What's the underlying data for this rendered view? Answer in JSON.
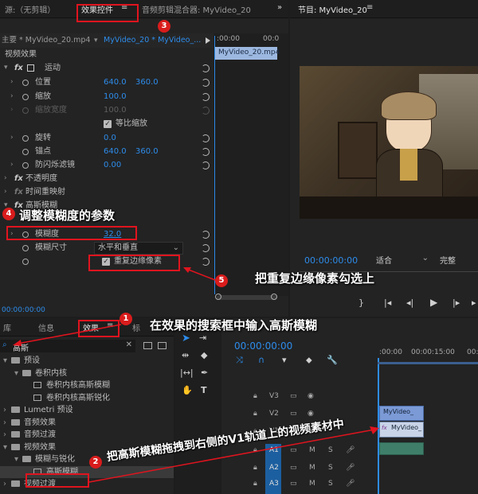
{
  "effect_controls": {
    "tabs": [
      "源:（无剪辑）",
      "效果控件",
      "音频剪辑混合器: MyVideo_20"
    ],
    "tab_menu": "≡",
    "more": "»",
    "breadcrumb_master": "主要 * MyVideo_20.mp4",
    "breadcrumb_seq": "MyVideo_20 * MyVideo_...",
    "ruler_start": ":00:00",
    "ruler_mid": "00:0",
    "clip_label": "MyVideo_20.mp4",
    "section_video": "视频效果",
    "motion": "运动",
    "position_label": "位置",
    "position_x": "640.0",
    "position_y": "360.0",
    "scale_label": "缩放",
    "scale_value": "100.0",
    "scale_width_label": "缩放宽度",
    "scale_width_value": "100.0",
    "uniform_scale": "等比缩放",
    "rotation_label": "旋转",
    "rotation_value": "0.0",
    "anchor_label": "锚点",
    "anchor_x": "640.0",
    "anchor_y": "360.0",
    "flicker_label": "防闪烁滤镜",
    "flicker_value": "0.00",
    "opacity": "不透明度",
    "time_remap": "时间重映射",
    "gaussian": "高斯模糊",
    "blurriness_label": "模糊度",
    "blurriness_value": "32.0",
    "blur_dim_label": "模糊尺寸",
    "blur_dim_value": "水平和垂直",
    "repeat_edge": "重复边缘像素",
    "footer_time": "00:00:00:00"
  },
  "program": {
    "title": "节目: MyVideo_20",
    "menu": "≡",
    "timecode": "00:00:00:00",
    "fit": "适合",
    "quality": "完整"
  },
  "effects": {
    "tabs": [
      "库",
      "信息",
      "效果",
      "标"
    ],
    "menu": "≡",
    "search_value": "高斯",
    "tree": [
      {
        "label": "预设",
        "indent": 0,
        "type": "folder",
        "expanded": true
      },
      {
        "label": "卷积内核",
        "indent": 1,
        "type": "folder",
        "expanded": true
      },
      {
        "label": "卷积内核高斯模糊",
        "indent": 2,
        "type": "preset"
      },
      {
        "label": "卷积内核高斯锐化",
        "indent": 2,
        "type": "preset"
      },
      {
        "label": "Lumetri 预设",
        "indent": 0,
        "type": "folder",
        "expanded": false
      },
      {
        "label": "音频效果",
        "indent": 0,
        "type": "folder",
        "expanded": false
      },
      {
        "label": "音频过渡",
        "indent": 0,
        "type": "folder",
        "expanded": false
      },
      {
        "label": "视频效果",
        "indent": 0,
        "type": "folder",
        "expanded": true
      },
      {
        "label": "模糊与锐化",
        "indent": 1,
        "type": "folder",
        "expanded": true
      },
      {
        "label": "高斯模糊",
        "indent": 2,
        "type": "effect",
        "selected": true
      },
      {
        "label": "视频过渡",
        "indent": 0,
        "type": "folder",
        "expanded": false
      }
    ]
  },
  "timeline": {
    "timecode": "00:00:00:00",
    "ruler_start": ":00:00",
    "ruler_mid": "00:00:15:00",
    "ruler_end": "00:",
    "tracks": [
      "V3",
      "V2",
      "V1",
      "A1",
      "A2",
      "A3"
    ],
    "clip_v2_label": "MyVideo_",
    "clip_v1_label": "MyVideo_"
  },
  "annotations": {
    "step1": "在效果的搜索框中输入高斯模糊",
    "step2": "把高斯模糊拖拽到右侧的V1轨道上的视频素材中",
    "step4": "调整模糊度的参数",
    "step5": "把重复边缘像素勾选上",
    "n1": "1",
    "n2": "2",
    "n3": "3",
    "n4": "4",
    "n5": "5"
  },
  "colors": {
    "accent": "#2d8ceb",
    "annotation_red": "#e0141e",
    "clip_blue": "#6e8cc8"
  }
}
